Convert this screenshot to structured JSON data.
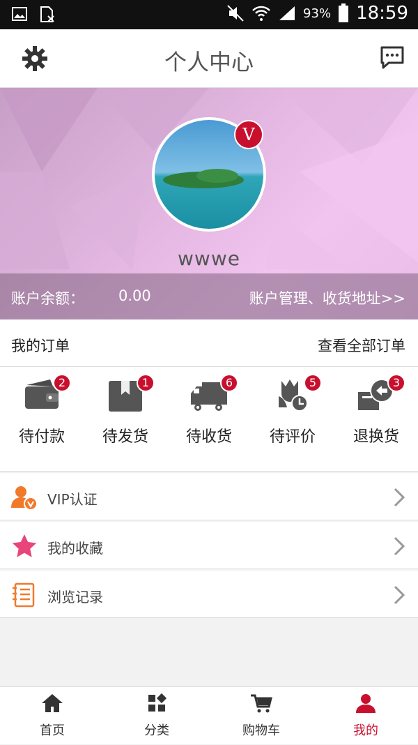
{
  "status_bar": {
    "battery": "93%",
    "time": "18:59"
  },
  "header": {
    "title": "个人中心"
  },
  "profile": {
    "username": "wwwe",
    "vip_badge": "V",
    "balance_label": "账户余额：",
    "balance_value": "0.00",
    "manage_link": "账户管理、收货地址>>"
  },
  "orders": {
    "title": "我的订单",
    "view_all": "查看全部订单",
    "statuses": [
      {
        "label": "待付款",
        "count": "2",
        "icon": "wallet-icon"
      },
      {
        "label": "待发货",
        "count": "1",
        "icon": "package-icon"
      },
      {
        "label": "待收货",
        "count": "6",
        "icon": "truck-icon"
      },
      {
        "label": "待评价",
        "count": "5",
        "icon": "review-icon"
      },
      {
        "label": "退换货",
        "count": "3",
        "icon": "return-icon"
      }
    ]
  },
  "menu": [
    {
      "label": "VIP认证",
      "icon": "vip-user-icon",
      "color": "#f07a2a"
    },
    {
      "label": "我的收藏",
      "icon": "star-icon",
      "color": "#e8457a"
    },
    {
      "label": "浏览记录",
      "icon": "history-icon",
      "color": "#f07a2a"
    }
  ],
  "tabbar": [
    {
      "label": "首页",
      "icon": "home-icon"
    },
    {
      "label": "分类",
      "icon": "category-icon"
    },
    {
      "label": "购物车",
      "icon": "cart-icon"
    },
    {
      "label": "我的",
      "icon": "user-icon",
      "active": true
    }
  ],
  "colors": {
    "accent": "#c8102e",
    "banner": "#e3b7e1"
  }
}
